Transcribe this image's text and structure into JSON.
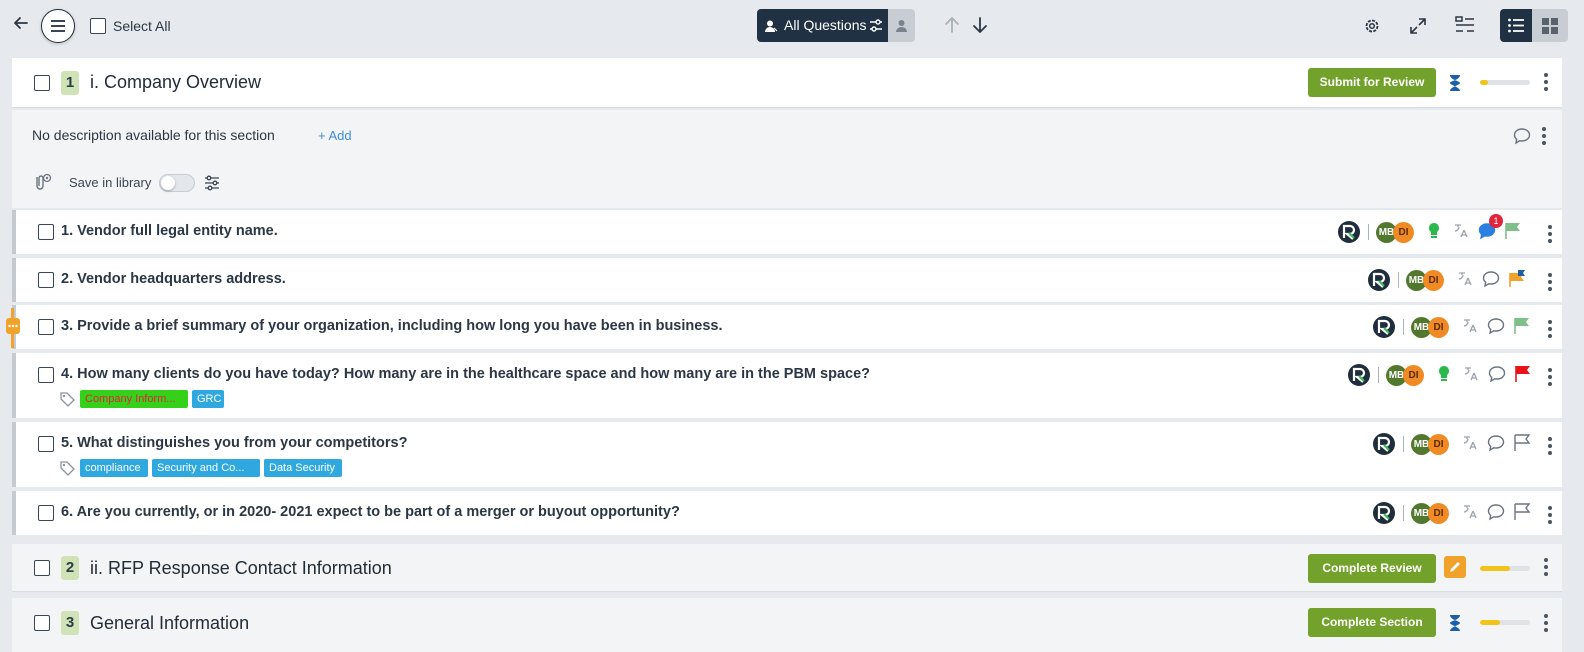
{
  "toolbar": {
    "select_all_label": "Select All",
    "filter_label": "All Questions"
  },
  "sections": [
    {
      "number": "1",
      "title": "i. Company Overview",
      "action_label": "Submit for Review",
      "status_icon": "hourglass-icon",
      "progress": 0.15
    },
    {
      "number": "2",
      "title": "ii. RFP Response Contact Information",
      "action_label": "Complete Review",
      "status_icon": "pencil-icon",
      "progress": 0.6
    },
    {
      "number": "3",
      "title": "General Information",
      "action_label": "Complete Section",
      "status_icon": "hourglass-icon",
      "progress": 0.4
    }
  ],
  "description": {
    "text": "No description available for this section",
    "add_label": "+ Add",
    "save_library_label": "Save in library",
    "save_library_on": false
  },
  "questions": [
    {
      "title": "1. Vendor full legal entity name.",
      "avatars": [
        "MB",
        "DI"
      ],
      "comment_count": "1",
      "flag_color": "#7fbf8a",
      "has_bulb": true,
      "tags": []
    },
    {
      "title": "2. Vendor headquarters address.",
      "avatars": [
        "MB",
        "DI"
      ],
      "flag_color": "#f1a22a",
      "has_bulb": false,
      "tags": []
    },
    {
      "title": "3. Provide a brief summary of your organization, including how long you have been in business.",
      "avatars": [
        "MB",
        "DI"
      ],
      "flag_color": "#7fbf8a",
      "has_bulb": false,
      "tags": []
    },
    {
      "title": "4. How many clients do you have today? How many are in the healthcare space and how many are in the PBM space?",
      "avatars": [
        "MB",
        "DI"
      ],
      "flag_color": "#e8141b",
      "has_bulb": true,
      "tags": [
        "Company Inform...",
        "GRC"
      ]
    },
    {
      "title": "5. What distinguishes you from your competitors?",
      "avatars": [
        "MB",
        "DI"
      ],
      "flag_color": "outline",
      "has_bulb": false,
      "tags": [
        "compliance",
        "Security and Co...",
        "Data Security"
      ]
    },
    {
      "title": "6. Are you currently, or in 2020- 2021 expect to be part of a merger or buyout opportunity?",
      "avatars": [
        "MB",
        "DI"
      ],
      "flag_color": "outline",
      "has_bulb": false,
      "tags": []
    }
  ],
  "colors": {
    "accent_dark": "#1f3142",
    "button_green": "#72a22b",
    "progress_yellow": "#f2c31a",
    "tag_blue": "#2fa8e0",
    "tag_green": "#35d11a"
  }
}
